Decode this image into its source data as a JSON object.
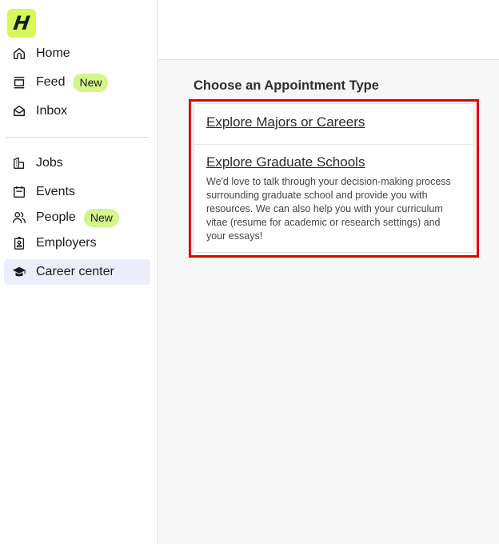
{
  "logo": {
    "letter": "H",
    "color": "#d7f75b"
  },
  "sidebar": {
    "primary": [
      {
        "label": "Home",
        "icon": "home-icon"
      },
      {
        "label": "Feed",
        "icon": "feed-icon",
        "badge": "New"
      },
      {
        "label": "Inbox",
        "icon": "inbox-icon"
      }
    ],
    "secondary": [
      {
        "label": "Jobs",
        "icon": "jobs-icon"
      },
      {
        "label": "Events",
        "icon": "calendar-icon"
      },
      {
        "label": "People",
        "icon": "people-icon",
        "badge": "New"
      },
      {
        "label": "Employers",
        "icon": "employers-badge-icon"
      },
      {
        "label": "Career center",
        "icon": "graduation-cap-icon",
        "active": true
      }
    ]
  },
  "main": {
    "section_title": "Choose an Appointment Type",
    "appointment_types": [
      {
        "title": "Explore Majors or Careers"
      },
      {
        "title": "Explore Graduate Schools",
        "description": "We'd love to talk through your decision-making process surrounding graduate school and provide you with resources. We can also help you with your curriculum vitae (resume for academic or research settings) and your essays!"
      }
    ]
  },
  "colors": {
    "accent_badge": "#d3f58a",
    "active_nav": "#ecedfb",
    "highlight": "#e00000"
  }
}
